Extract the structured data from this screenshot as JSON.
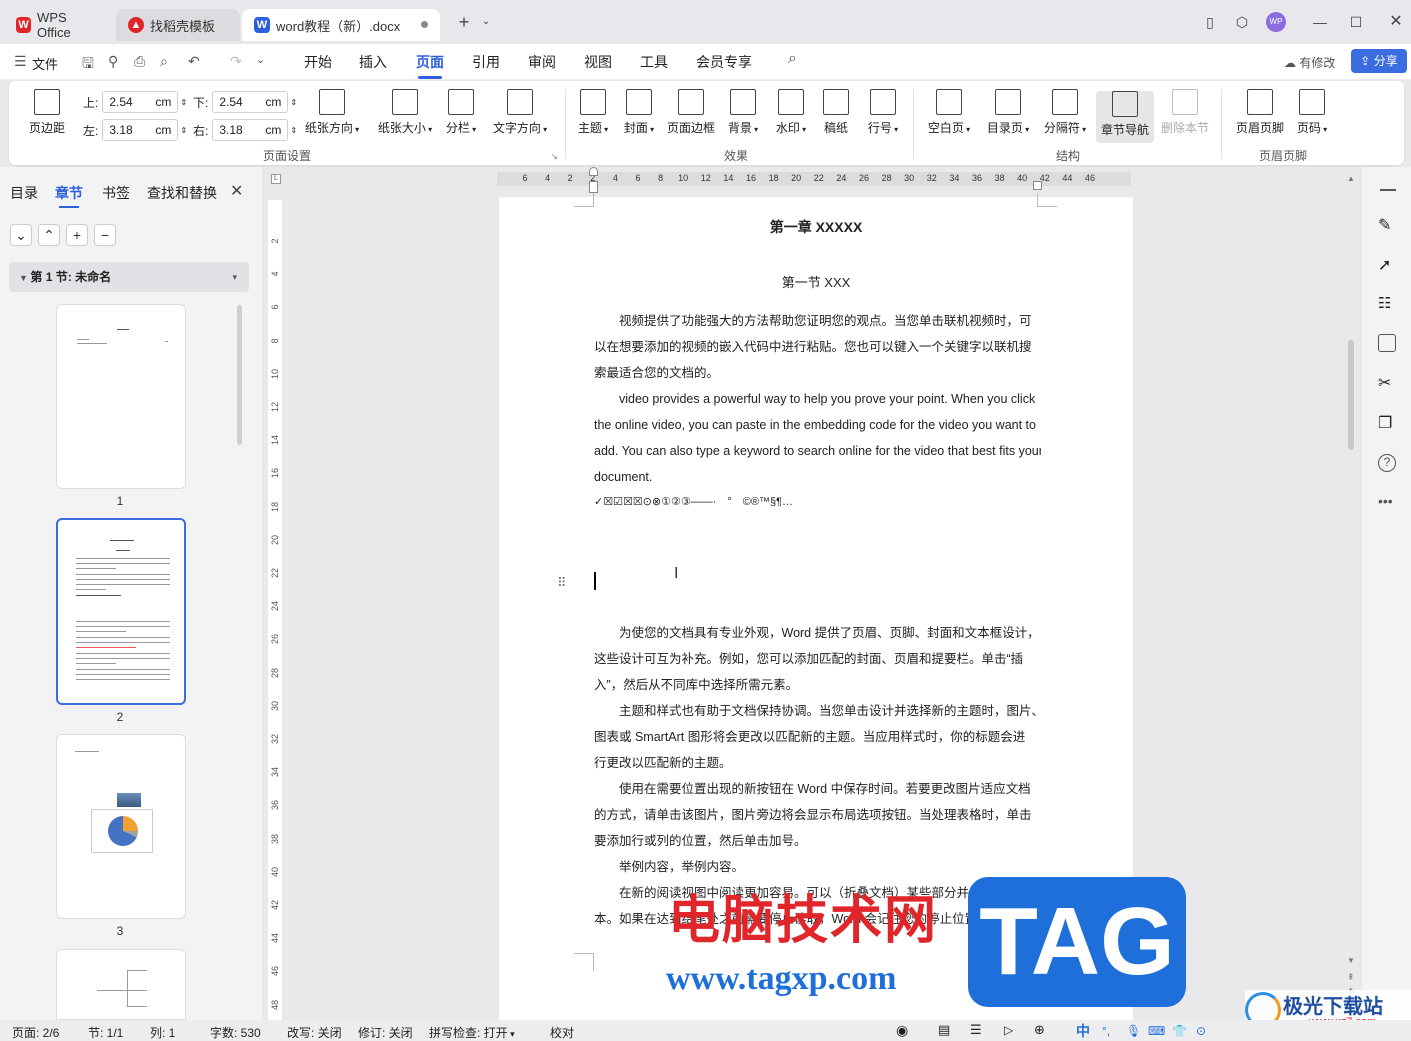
{
  "tabs": [
    {
      "label": "WPS Office"
    },
    {
      "label": "找稻壳模板"
    },
    {
      "label": "word教程（新）.docx"
    }
  ],
  "menu": {
    "file": "文件",
    "items": [
      "开始",
      "插入",
      "页面",
      "引用",
      "审阅",
      "视图",
      "工具",
      "会员专享"
    ],
    "active": "页面",
    "modified": "有修改",
    "share": "分享"
  },
  "ribbon": {
    "margin_label": "页边距",
    "top_label": "上:",
    "top_value": "2.54",
    "bottom_label": "下:",
    "bottom_value": "2.54",
    "left_label": "左:",
    "left_value": "3.18",
    "right_label": "右:",
    "right_value": "3.18",
    "unit": "cm",
    "page_setup_buttons": [
      "纸张方向",
      "纸张大小",
      "分栏",
      "文字方向"
    ],
    "effect_buttons": [
      "主题",
      "封面",
      "页面边框",
      "背景",
      "水印",
      "稿纸",
      "行号"
    ],
    "structure_buttons": [
      "空白页",
      "目录页",
      "分隔符",
      "章节导航",
      "删除本节"
    ],
    "hf_buttons": [
      "页眉页脚",
      "页码"
    ],
    "groups": [
      "页面设置",
      "效果",
      "结构",
      "页眉页脚"
    ]
  },
  "left_panel": {
    "tabs": [
      "目录",
      "章节",
      "书签",
      "查找和替换"
    ],
    "active_tab": "章节",
    "section_label": "第 1 节: 未命名",
    "thumb_labels": [
      "1",
      "2",
      "3"
    ]
  },
  "ruler": {
    "h": [
      "6",
      "4",
      "2",
      "2",
      "4",
      "6",
      "8",
      "10",
      "12",
      "14",
      "16",
      "18",
      "20",
      "22",
      "24",
      "26",
      "28",
      "30",
      "32",
      "34",
      "36",
      "38",
      "40",
      "42",
      "44",
      "46"
    ],
    "v": [
      "2",
      "4",
      "6",
      "8",
      "10",
      "12",
      "14",
      "16",
      "18",
      "20",
      "22",
      "24",
      "26",
      "28",
      "30",
      "32",
      "34",
      "36",
      "38",
      "40",
      "42",
      "44",
      "46",
      "48"
    ]
  },
  "document": {
    "chapter": "第一章 XXXXX",
    "section": "第一节 XXX",
    "paragraphs": [
      "　　视频提供了功能强大的方法帮助您证明您的观点。当您单击联机视频时，可",
      "以在想要添加的视频的嵌入代码中进行粘贴。您也可以键入一个关键字以联机搜",
      "索最适合您的文档的。",
      "　　video provides a powerful way to help you prove your point. When you click",
      "the online video, you can paste in the embedding code for the video you want to",
      "add. You can also type a keyword to search online for the video that best fits your",
      "document.",
      "✓☒☑☒☒⊙⊗①②③——·　°　©®™§¶…"
    ],
    "paragraphs2": [
      "　　为使您的文档具有专业外观，Word 提供了页眉、页脚、封面和文本框设计，",
      "这些设计可互为补充。例如，您可以添加匹配的封面、页眉和提要栏。单击“插",
      "入”，然后从不同库中选择所需元素。",
      "　　主题和样式也有助于文档保持协调。当您单击设计并选择新的主题时，图片、",
      "图表或 SmartArt 图形将会更改以匹配新的主题。当应用样式时，你的标题会进",
      "行更改以匹配新的主题。",
      "　　使用在需要位置出现的新按钮在 Word 中保存时间。若要更改图片适应文档",
      "的方式，请单击该图片，图片旁边将会显示布局选项按钮。当处理表格时，单击",
      "要添加行或列的位置，然后单击加号。",
      "　　举例内容，举例内容。",
      "　　在新的阅读视图中阅读更加容易。可以（折叠文档）某些部分并关注所需文",
      "本。如果在达到结尾处之前需要停止读取，Word 会记住您的停止位置 - 即使"
    ]
  },
  "watermark": {
    "text1": "电脑技术网",
    "text2": "www.tagxp.com",
    "logo": "TAG",
    "brand": "极光下载站",
    "brand_url": "www.xz7.com"
  },
  "status": {
    "page": "页面: 2/6",
    "section": "节: 1/1",
    "column": "列: 1",
    "words": "字数: 530",
    "revise": "改写: 关闭",
    "track": "修订: 关闭",
    "spell": "拼写检查: 打开",
    "proof": "校对",
    "ime": "中"
  },
  "colors": {
    "accent": "#2c5fdc",
    "watermark_red": "#e0262b",
    "watermark_blue": "#1e6fd9"
  }
}
